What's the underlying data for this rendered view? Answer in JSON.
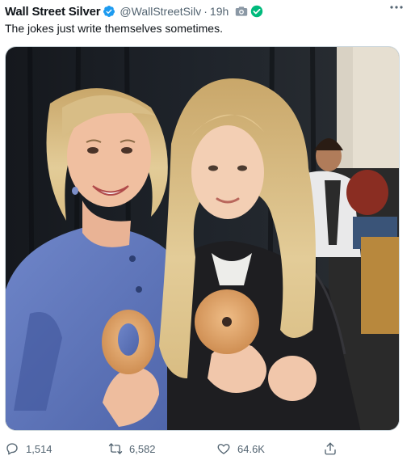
{
  "tweet": {
    "author_name": "Wall Street Silver",
    "handle": "@WallStreetSilv",
    "separator": "·",
    "time": "19h",
    "text": "The jokes just write themselves sometimes."
  },
  "actions": {
    "replies": "1,514",
    "retweets": "6,582",
    "likes": "64.6K"
  },
  "colors": {
    "verified": "#1d9bf0",
    "secondary_text": "#536471",
    "check_badge": "#00ba7c"
  },
  "icons": [
    "verified-badge-icon",
    "camera-icon",
    "check-badge-icon",
    "more-options-icon",
    "reply-icon",
    "retweet-icon",
    "like-icon",
    "share-icon"
  ]
}
